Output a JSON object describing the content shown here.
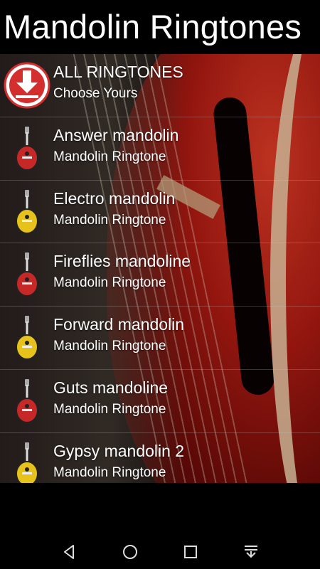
{
  "app": {
    "title": "Mandolin Ringtones"
  },
  "list": {
    "items": [
      {
        "title": "ALL RINGTONES",
        "subtitle": "Choose Yours",
        "icon": "download-icon"
      },
      {
        "title": "Answer mandolin",
        "subtitle": "Mandolin Ringtone",
        "icon": "mandolin-red-icon"
      },
      {
        "title": "Electro mandolin",
        "subtitle": "Mandolin Ringtone",
        "icon": "mandolin-yellow-icon"
      },
      {
        "title": "Fireflies mandoline",
        "subtitle": "Mandolin Ringtone",
        "icon": "mandolin-red-icon"
      },
      {
        "title": "Forward mandolin",
        "subtitle": "Mandolin Ringtone",
        "icon": "mandolin-yellow-icon"
      },
      {
        "title": "Guts mandoline",
        "subtitle": "Mandolin Ringtone",
        "icon": "mandolin-red-icon"
      },
      {
        "title": "Gypsy mandolin 2",
        "subtitle": "Mandolin Ringtone",
        "icon": "mandolin-yellow-icon"
      }
    ]
  },
  "navbar": {
    "buttons": [
      "back-icon",
      "home-icon",
      "recents-icon",
      "notifications-pull-icon"
    ]
  },
  "colors": {
    "accent_red": "#d32f2f",
    "mandolin_red": "#c62828",
    "mandolin_yellow": "#e6c21a"
  }
}
